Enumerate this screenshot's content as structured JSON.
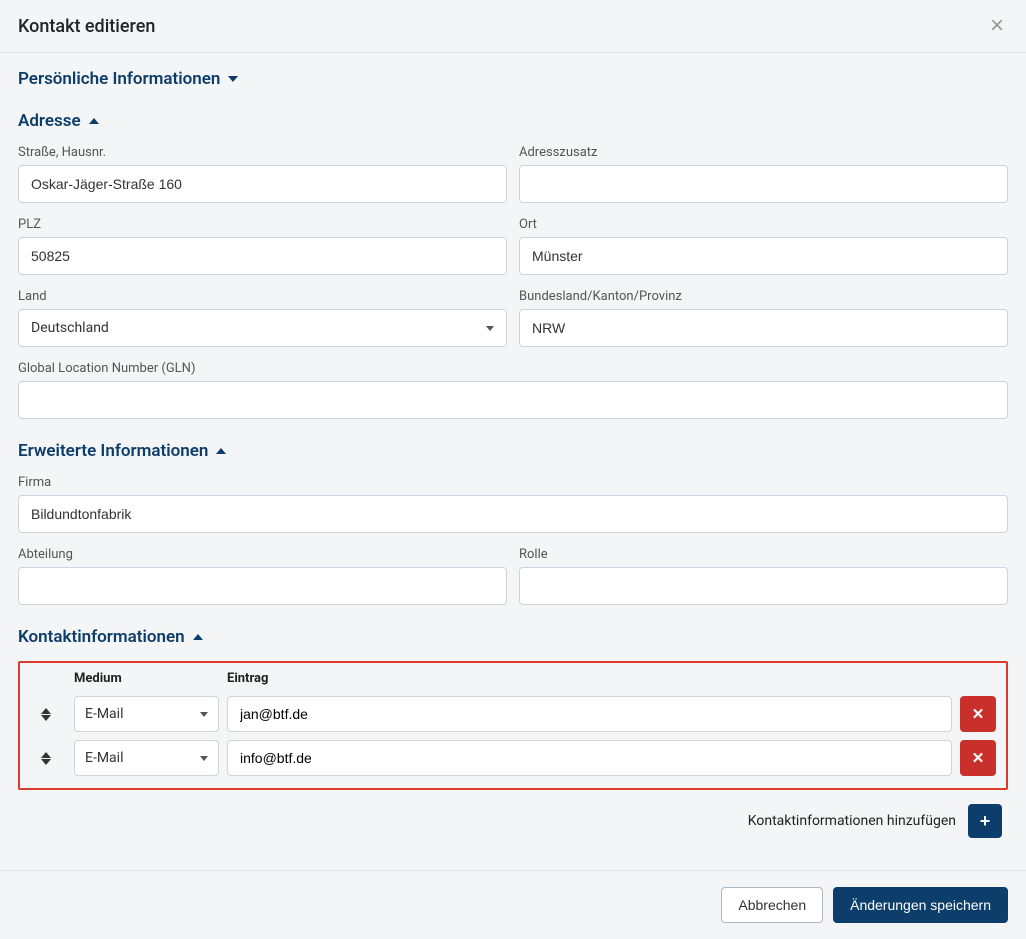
{
  "header": {
    "title": "Kontakt editieren"
  },
  "sections": {
    "personal": {
      "title": "Persönliche Informationen"
    },
    "address": {
      "title": "Adresse",
      "street_label": "Straße, Hausnr.",
      "street_value": "Oskar-Jäger-Straße 160",
      "addon_label": "Adresszusatz",
      "addon_value": "",
      "zip_label": "PLZ",
      "zip_value": "50825",
      "city_label": "Ort",
      "city_value": "Münster",
      "country_label": "Land",
      "country_value": "Deutschland",
      "state_label": "Bundesland/Kanton/Provinz",
      "state_value": "NRW",
      "gln_label": "Global Location Number (GLN)",
      "gln_value": ""
    },
    "extended": {
      "title": "Erweiterte Informationen",
      "company_label": "Firma",
      "company_value": "Bildundtonfabrik",
      "department_label": "Abteilung",
      "department_value": "",
      "role_label": "Rolle",
      "role_value": ""
    },
    "contact": {
      "title": "Kontaktinformationen",
      "col_medium": "Medium",
      "col_entry": "Eintrag",
      "rows": [
        {
          "medium": "E-Mail",
          "entry": "jan@btf.de"
        },
        {
          "medium": "E-Mail",
          "entry": "info@btf.de"
        }
      ],
      "add_label": "Kontaktinformationen hinzufügen"
    }
  },
  "footer": {
    "cancel": "Abbrechen",
    "save": "Änderungen speichern"
  }
}
